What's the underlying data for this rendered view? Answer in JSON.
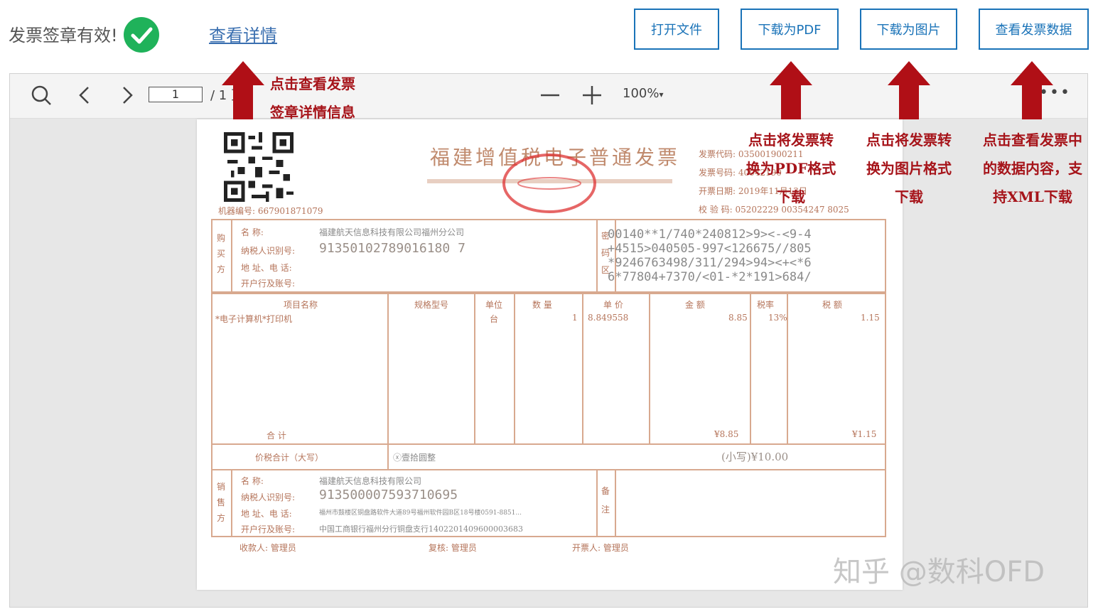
{
  "header": {
    "status_text": "发票签章有效!",
    "detail_link": "查看详情"
  },
  "toolbar": {
    "open_file": "打开文件",
    "download_pdf": "下载为PDF",
    "download_image": "下载为图片",
    "view_data": "查看发票数据"
  },
  "viewer": {
    "page_current": "1",
    "page_total": "/ 1 页",
    "zoom": "100%",
    "more": "•••"
  },
  "invoice": {
    "title": "福建增值税电子普通发票",
    "machine_no": "机器编号: 667901871079",
    "meta": [
      "发票代码: 035001900211",
      "发票号码: 40042190",
      "开票日期: 2019年11月13日",
      "校 验 码: 05202229 00354247 8025"
    ],
    "buyer": {
      "side_label": "购买方",
      "name_label": "名 称:",
      "name": "福建航天信息科技有限公司福州分公司",
      "tax_label": "纳税人识别号:",
      "tax_id": "91350102789016180 7",
      "addr_label": "地 址、电 话:",
      "bank_label": "开户行及账号:"
    },
    "cipher_label": "密码区",
    "cipher": [
      "00140**1/740*240812>9><-<9-4",
      "+4515>040505-997<126675//805",
      "*9246763498/311/294>94><+<*6",
      "6*77804+7370/<01-*2*191>684/"
    ],
    "columns": [
      "项目名称",
      "规格型号",
      "单位",
      "数 量",
      "单 价",
      "金 额",
      "税率",
      "税 额"
    ],
    "item": {
      "name": "*电子计算机*打印机",
      "unit": "台",
      "qty": "1",
      "price": "8.849558",
      "amount": "8.85",
      "rate": "13%",
      "tax": "1.15"
    },
    "total_label": "合 计",
    "total_amount": "¥8.85",
    "total_tax": "¥1.15",
    "words_label": "价税合计（大写）",
    "words": "ⓧ壹拾圆整",
    "small_total": "(小写)¥10.00",
    "seller": {
      "side_label": "销售方",
      "name_label": "名 称:",
      "name": "福建航天信息科技有限公司",
      "tax_label": "纳税人识别号:",
      "tax_id": "913500007593710695",
      "addr_label": "地 址、电 话:",
      "addr": "福州市鼓楼区铜盘路软件大道89号福州软件园B区18号楼0591-8851...",
      "bank_label": "开户行及账号:",
      "bank": "中国工商银行福州分行铜盘支行1402201409600003683"
    },
    "remark_label": "备注",
    "footer": [
      "收款人: 管理员",
      "复核: 管理员",
      "开票人: 管理员"
    ]
  },
  "annotations": {
    "details": [
      "点击查看发票",
      "签章详情信息"
    ],
    "pdf": [
      "点击将发票转",
      "换为PDF格式",
      "下载"
    ],
    "image": [
      "点击将发票转",
      "换为图片格式",
      "下载"
    ],
    "data": [
      "点击查看发票中",
      "的数据内容，支",
      "持XML下载"
    ]
  },
  "watermark": "知乎 @数科OFD",
  "colors": {
    "accent": "#1a73b8",
    "annotation": "#a6141a",
    "success": "#1fb25a",
    "invoice_line": "#d8a98f"
  }
}
